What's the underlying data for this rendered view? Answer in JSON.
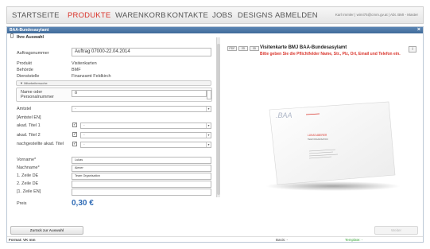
{
  "nav": {
    "items": [
      "STARTSEITE",
      "PRODUKTE",
      "WARENKORB",
      "KONTAKTE",
      "JOBS",
      "DESIGNS",
      "ABMELDEN"
    ],
    "user": "Karl Immler | wimi75@cmm.gv.at | Abt. BMI - Master"
  },
  "dialog": {
    "title": "BAA-Bundesasylamt",
    "close": "×"
  },
  "form": {
    "section_title": "Ihre Auswahl",
    "auftragsnummer_label": "Auftragsnummer",
    "auftragsnummer_value": "Auftrag 07000-22.04.2014",
    "produkt_label": "Produkt",
    "produkt_value": "Visitenkarten",
    "behoerde_label": "Behörde",
    "behoerde_value": "BMF",
    "dienststelle_label": "Dienststelle",
    "dienststelle_value": "Finanzamt Feldkirch",
    "mitarbeitersuche": "▼ Mitarbeitersuche",
    "name_label": "Name oder Personalnummer",
    "name_value": "ö",
    "amtstel_label": "Amtstel",
    "amtstel_en_label": "[Amtstel EN]",
    "akad_titel1_label": "akad. Titel 1",
    "akad_titel2_label": "akad. Titel 2",
    "nachgestellt_label": "nachgestellte akad. Titel",
    "vorname_label": "Vorname*",
    "vorname_value": "Lukas",
    "nachname_label": "Nachname*",
    "nachname_value": "Alexer",
    "zeile1_label": "1. Zeile DE",
    "zeile1_value": "Team Organisation",
    "zeile2_label": "2. Zeile DE",
    "zeile1en_label": "[1. Zeile EN]",
    "preis_label": "Preis",
    "preis_value": "0,30 €",
    "select_placeholder": "-",
    "checkbox_mark": "✓"
  },
  "preview": {
    "btn_pdf": "PDF",
    "btn_2d": "2D",
    "btn_3d": "3D",
    "title": "Visitenkarte BMJ BAA-Bundesasylamt",
    "subtitle": "Bitte geben Sie die Pflichtfelder Name, Str., Plz, Ort, Email und Telefon ein.",
    "info": "i",
    "card_logo": ".BAA",
    "card_name": "LUKAS ABERER",
    "card_org": "TEAM ORGANISATION"
  },
  "buttons": {
    "back": "Zurück zur Auswahl",
    "next": "Weiter"
  },
  "footer": {
    "format": "Format: VK mm",
    "basis": "Basis: -",
    "template": "Template: -"
  },
  "colors": {
    "accent": "#d9342b",
    "price": "#2f6bb5",
    "titlebar": "#4a76a5"
  }
}
